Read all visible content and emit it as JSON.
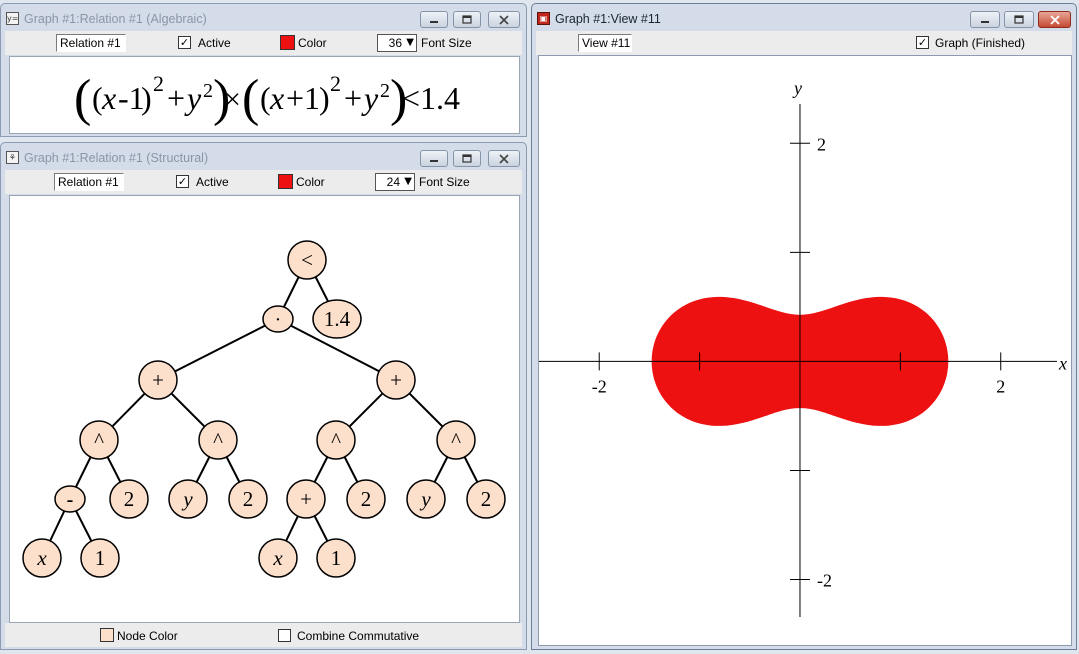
{
  "algebraic_window": {
    "title": "Graph #1:Relation #1 (Algebraic)",
    "relation_name": "Relation #1",
    "active_label": "Active",
    "active_checked": true,
    "color_label": "Color",
    "color_value": "#ee1111",
    "font_size_value": "36",
    "font_size_label": "Font Size",
    "expression": {
      "open_outer_paren": "(",
      "close_outer_paren": ")",
      "inner_open": "(",
      "inner_close": ")",
      "var_x": "x",
      "var_y": "y",
      "minus_one": "-1",
      "plus_one": "+1",
      "exponent": "2",
      "plus": "+",
      "times": "×",
      "relation_rhs": "<1.4"
    }
  },
  "structural_window": {
    "title": "Graph #1:Relation #1 (Structural)",
    "relation_name": "Relation #1",
    "active_label": "Active",
    "active_checked": true,
    "color_label": "Color",
    "color_value": "#ee1111",
    "font_size_value": "24",
    "font_size_label": "Font Size",
    "node_color_label": "Node Color",
    "node_color_value": "#fde0cc",
    "combine_commutative_label": "Combine Commutative",
    "combine_commutative_checked": false,
    "tree_nodes": [
      {
        "id": "lt",
        "label": "<",
        "italic": false
      },
      {
        "id": "dot",
        "label": "·",
        "italic": false
      },
      {
        "id": "c14",
        "label": "1.4",
        "italic": false
      },
      {
        "id": "plus_l",
        "label": "+",
        "italic": false
      },
      {
        "id": "plus_r",
        "label": "+",
        "italic": false
      },
      {
        "id": "pow_ll",
        "label": "^",
        "italic": false
      },
      {
        "id": "pow_lr",
        "label": "^",
        "italic": false
      },
      {
        "id": "pow_rl",
        "label": "^",
        "italic": false
      },
      {
        "id": "pow_rr",
        "label": "^",
        "italic": false
      },
      {
        "id": "minus",
        "label": "-",
        "italic": false
      },
      {
        "id": "two_a",
        "label": "2",
        "italic": false
      },
      {
        "id": "y_a",
        "label": "y",
        "italic": true
      },
      {
        "id": "two_b",
        "label": "2",
        "italic": false
      },
      {
        "id": "plus_c",
        "label": "+",
        "italic": false
      },
      {
        "id": "two_c",
        "label": "2",
        "italic": false
      },
      {
        "id": "y_b",
        "label": "y",
        "italic": true
      },
      {
        "id": "two_d",
        "label": "2",
        "italic": false
      },
      {
        "id": "x_a",
        "label": "x",
        "italic": true
      },
      {
        "id": "one_a",
        "label": "1",
        "italic": false
      },
      {
        "id": "x_b",
        "label": "x",
        "italic": true
      },
      {
        "id": "one_b",
        "label": "1",
        "italic": false
      }
    ],
    "tree_edges": [
      [
        "lt",
        "dot"
      ],
      [
        "lt",
        "c14"
      ],
      [
        "dot",
        "plus_l"
      ],
      [
        "dot",
        "plus_r"
      ],
      [
        "plus_l",
        "pow_ll"
      ],
      [
        "plus_l",
        "pow_lr"
      ],
      [
        "plus_r",
        "pow_rl"
      ],
      [
        "plus_r",
        "pow_rr"
      ],
      [
        "pow_ll",
        "minus"
      ],
      [
        "pow_ll",
        "two_a"
      ],
      [
        "pow_lr",
        "y_a"
      ],
      [
        "pow_lr",
        "two_b"
      ],
      [
        "pow_rl",
        "plus_c"
      ],
      [
        "pow_rl",
        "two_c"
      ],
      [
        "pow_rr",
        "y_b"
      ],
      [
        "pow_rr",
        "two_d"
      ],
      [
        "minus",
        "x_a"
      ],
      [
        "minus",
        "one_a"
      ],
      [
        "plus_c",
        "x_b"
      ],
      [
        "plus_c",
        "one_b"
      ]
    ]
  },
  "view_window": {
    "title": "Graph #1:View #11",
    "view_name": "View #11",
    "graph_label": "Graph (Finished)",
    "graph_checked": true,
    "region_color": "#ee1111",
    "x_axis_label": "x",
    "y_axis_label": "y",
    "tick_labels": {
      "x_neg": "-2",
      "x_pos": "2",
      "y_pos": "2",
      "y_neg": "-2"
    }
  },
  "chart_data": {
    "type": "area",
    "title": "",
    "xlabel": "x",
    "ylabel": "y",
    "relation": "((x-1)^2+y^2)×((x+1)^2+y^2)<1.4",
    "xlim": [
      -2.6,
      2.7
    ],
    "ylim": [
      -2.6,
      2.8
    ],
    "x_ticks": [
      -2,
      -1,
      0,
      1,
      2
    ],
    "y_ticks": [
      -2,
      -1,
      0,
      1,
      2
    ],
    "x_tick_labels": [
      "-2",
      "2"
    ],
    "y_tick_labels": [
      "-2",
      "2"
    ],
    "grid": false,
    "fill_color": "#ee1111"
  }
}
